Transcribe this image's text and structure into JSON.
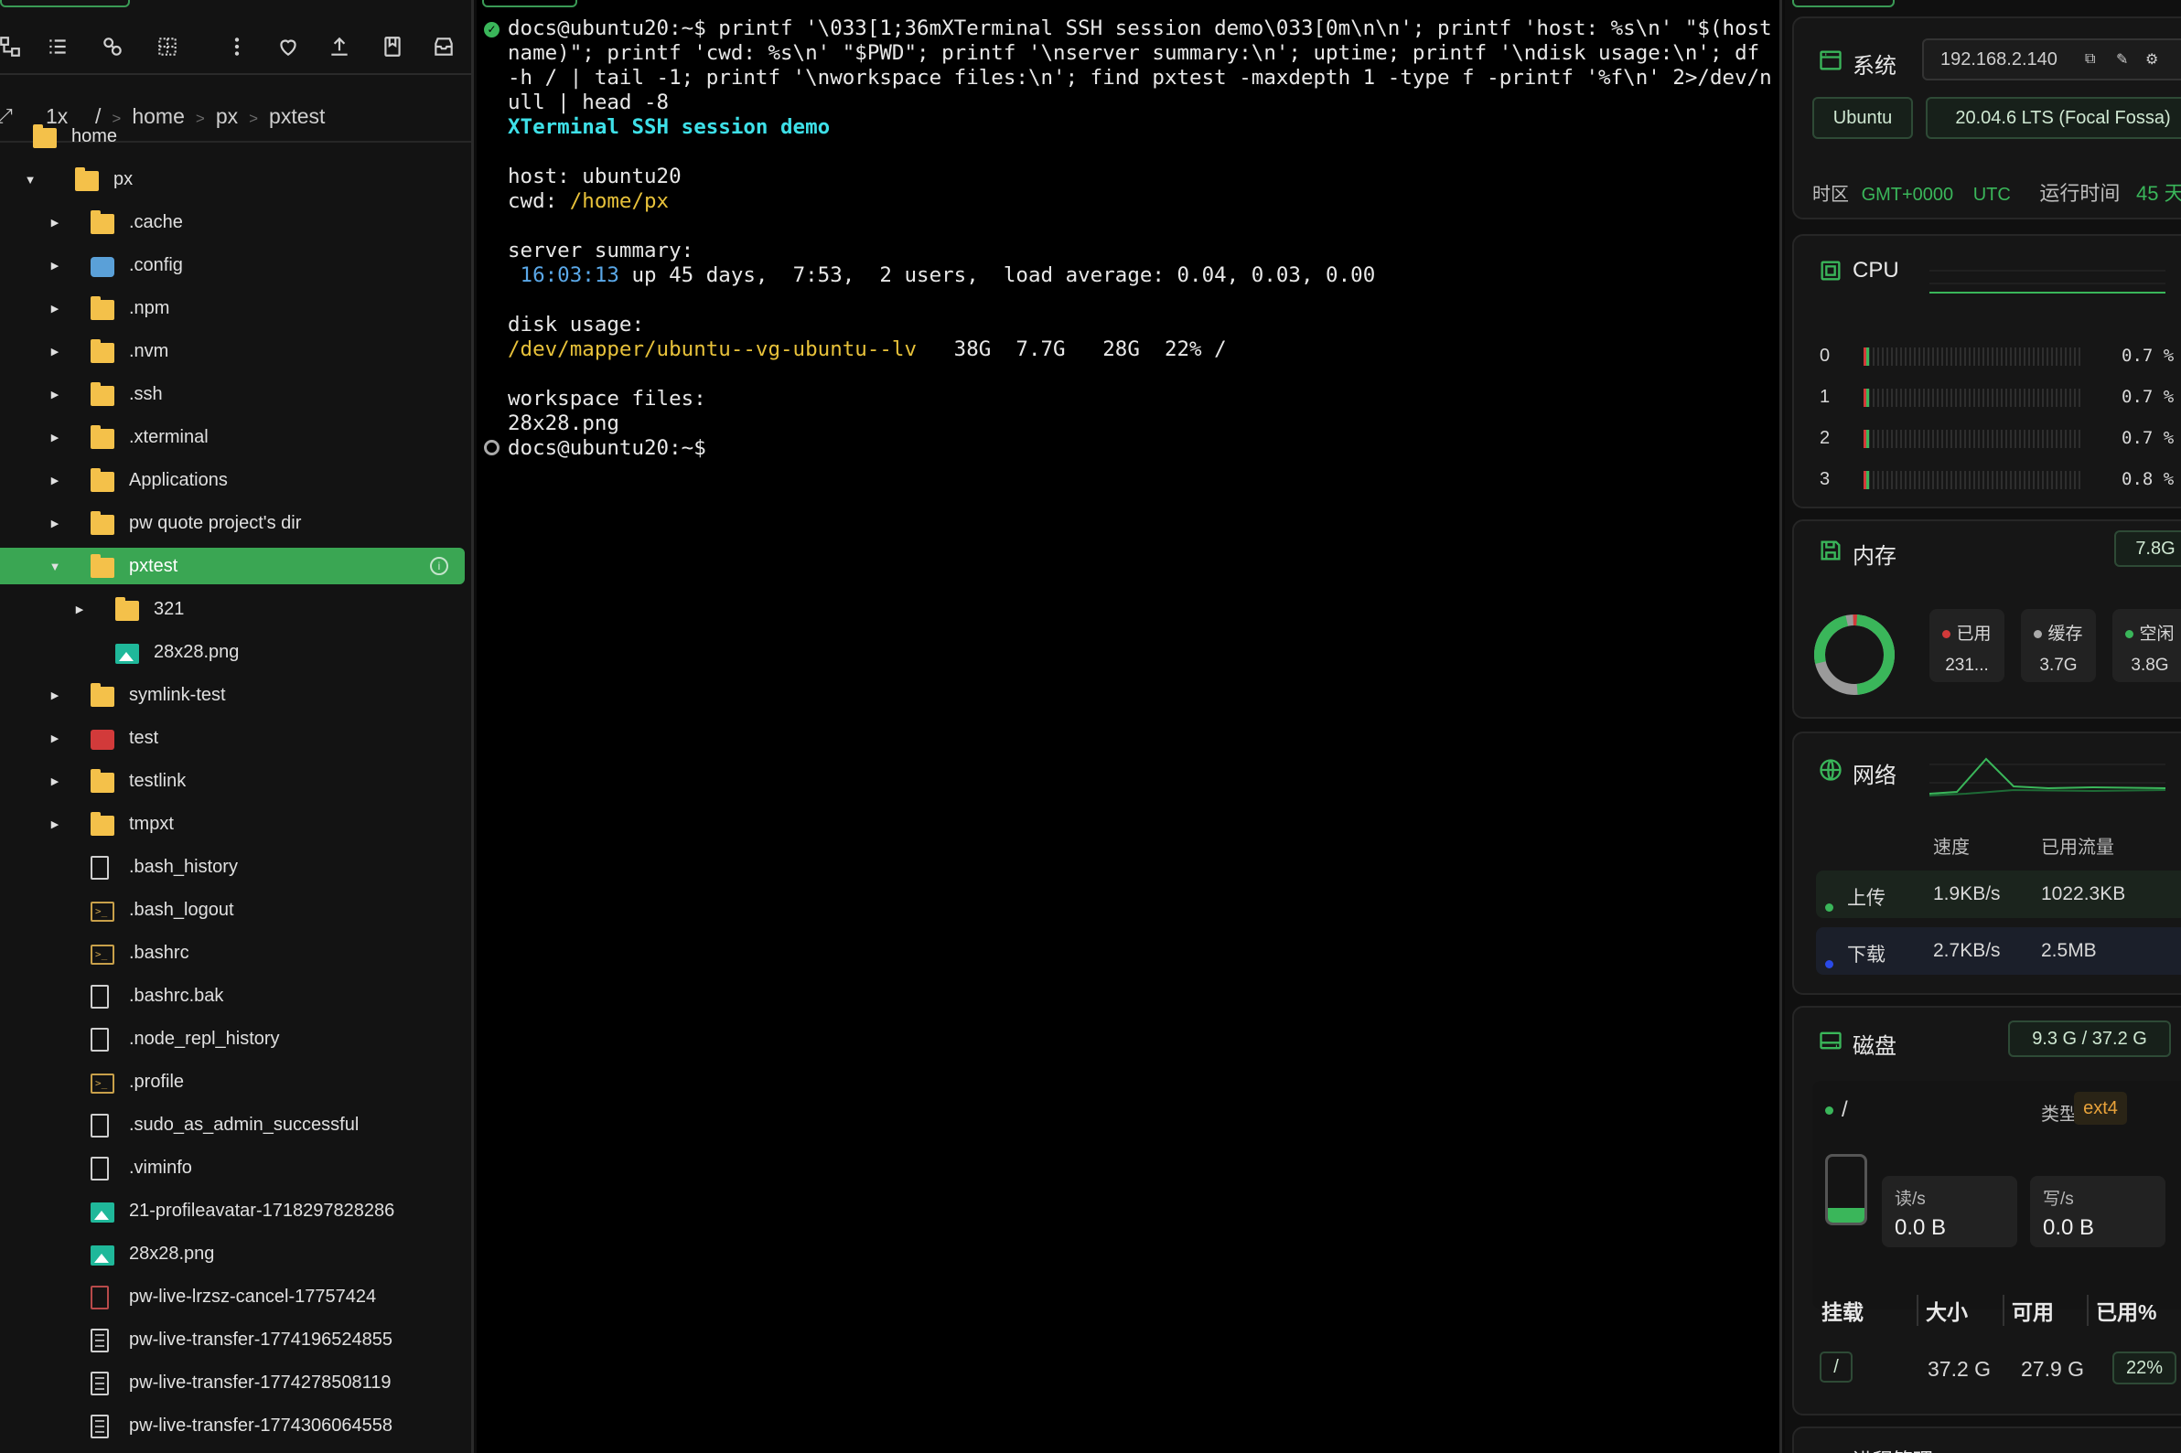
{
  "left": {
    "zoom": "1x",
    "breadcrumb": [
      "/",
      "home",
      "px",
      "pxtest"
    ],
    "tree": [
      {
        "label": "home",
        "kind": "folder",
        "caret": ""
      },
      {
        "label": "px",
        "kind": "folder",
        "caret": "open"
      },
      {
        "label": ".cache",
        "kind": "folder",
        "caret": "closed"
      },
      {
        "label": ".config",
        "kind": "gear",
        "caret": "closed"
      },
      {
        "label": ".npm",
        "kind": "folder",
        "caret": "closed"
      },
      {
        "label": ".nvm",
        "kind": "folder",
        "caret": "closed"
      },
      {
        "label": ".ssh",
        "kind": "folder",
        "caret": "closed"
      },
      {
        "label": ".xterminal",
        "kind": "folder",
        "caret": "closed"
      },
      {
        "label": "Applications",
        "kind": "folder",
        "caret": "closed"
      },
      {
        "label": "pw quote project's dir",
        "kind": "folder",
        "caret": "closed"
      },
      {
        "label": "pxtest",
        "kind": "folder",
        "caret": "open",
        "selected": true
      },
      {
        "label": "321",
        "kind": "folder",
        "caret": "closed"
      },
      {
        "label": "28x28.png",
        "kind": "image",
        "caret": ""
      },
      {
        "label": "symlink-test",
        "kind": "folder",
        "caret": "closed"
      },
      {
        "label": "test",
        "kind": "red",
        "caret": "closed"
      },
      {
        "label": "testlink",
        "kind": "folder",
        "caret": "closed"
      },
      {
        "label": "tmpxt",
        "kind": "folder",
        "caret": "closed"
      },
      {
        "label": ".bash_history",
        "kind": "file",
        "caret": ""
      },
      {
        "label": ".bash_logout",
        "kind": "shell",
        "caret": ""
      },
      {
        "label": ".bashrc",
        "kind": "shell",
        "caret": ""
      },
      {
        "label": ".bashrc.bak",
        "kind": "file",
        "caret": ""
      },
      {
        "label": ".node_repl_history",
        "kind": "file",
        "caret": ""
      },
      {
        "label": ".profile",
        "kind": "shell",
        "caret": ""
      },
      {
        "label": ".sudo_as_admin_successful",
        "kind": "file",
        "caret": ""
      },
      {
        "label": ".viminfo",
        "kind": "file",
        "caret": ""
      },
      {
        "label": "21-profileavatar-1718297828286",
        "kind": "image",
        "caret": ""
      },
      {
        "label": "28x28.png",
        "kind": "image",
        "caret": ""
      },
      {
        "label": "pw-live-lrzsz-cancel-17757424",
        "kind": "pdf",
        "caret": ""
      },
      {
        "label": "pw-live-transfer-1774196524855",
        "kind": "doc",
        "caret": ""
      },
      {
        "label": "pw-live-transfer-1774278508119",
        "kind": "doc",
        "caret": ""
      },
      {
        "label": "pw-live-transfer-1774306064558",
        "kind": "doc",
        "caret": ""
      }
    ]
  },
  "terminal": {
    "cmd_lines": [
      "docs@ubuntu20:~$ printf '\\033[1;36mXTerminal SSH session demo\\033[0m\\n\\n'; printf 'host: %s\\n' \"$(host",
      "name)\"; printf 'cwd: %s\\n' \"$PWD\"; printf '\\nserver summary:\\n'; uptime; printf '\\ndisk usage:\\n'; df",
      "-h / | tail -1; printf '\\nworkspace files:\\n'; find pxtest -maxdepth 1 -type f -printf '%f\\n' 2>/dev/n",
      "ull | head -8"
    ],
    "banner": "XTerminal SSH session demo",
    "host_line": "host: ubuntu20",
    "cwd_label": "cwd: ",
    "cwd_value": "/home/px",
    "summary_label": "server summary:",
    "uptime_time": "16:03:13",
    "uptime_rest": " up 45 days,  7:53,  2 users,  load average: 0.04, 0.03, 0.00",
    "disk_label": "disk usage:",
    "disk_dev": "/dev/mapper/ubuntu--vg-ubuntu--lv",
    "disk_rest": "   38G  7.7G   28G  22% /",
    "files_label": "workspace files:",
    "file_1": "28x28.png",
    "prompt": "docs@ubuntu20:~$"
  },
  "right": {
    "system": {
      "title": "系统",
      "ip": "192.168.2.140",
      "os": "Ubuntu",
      "version": "20.04.6 LTS (Focal Fossa)",
      "tz_label": "时区",
      "tz_offset": "GMT+0000",
      "tz_name": "UTC",
      "uptime_label": "运行时间",
      "uptime_value": "45 天"
    },
    "cpu": {
      "title": "CPU",
      "cores": [
        {
          "id": "0",
          "pct": "0.7 %",
          "value": 0.7
        },
        {
          "id": "1",
          "pct": "0.7 %",
          "value": 0.7
        },
        {
          "id": "2",
          "pct": "0.7 %",
          "value": 0.7
        },
        {
          "id": "3",
          "pct": "0.8 %",
          "value": 0.8
        }
      ]
    },
    "memory": {
      "title": "内存",
      "total": "7.8G",
      "used_label": "已用",
      "used_value": "231...",
      "cache_label": "缓存",
      "cache_value": "3.7G",
      "free_label": "空闲",
      "free_value": "3.8G"
    },
    "network": {
      "title": "网络",
      "col_speed": "速度",
      "col_total": "已用流量",
      "up_label": "上传",
      "up_speed": "1.9KB/s",
      "up_total": "1022.3KB",
      "down_label": "下载",
      "down_speed": "2.7KB/s",
      "down_total": "2.5MB"
    },
    "disk": {
      "title": "磁盘",
      "usage": "9.3 G / 37.2 G",
      "mount": "/",
      "type_label": "类型",
      "type_value": "ext4",
      "read_label": "读/s",
      "read_value": "0.0 B",
      "write_label": "写/s",
      "write_value": "0.0 B",
      "headers": [
        "挂载",
        "大小",
        "可用",
        "已用%"
      ],
      "row": {
        "mount": "/",
        "size": "37.2 G",
        "avail": "27.9 G",
        "used_pct": "22%"
      }
    },
    "next_card_title": "进程管理"
  },
  "colors": {
    "accent": "#3ab65a",
    "folder": "#f4c14a",
    "cyan": "#3ee0e8",
    "yellow": "#e8c23a"
  }
}
